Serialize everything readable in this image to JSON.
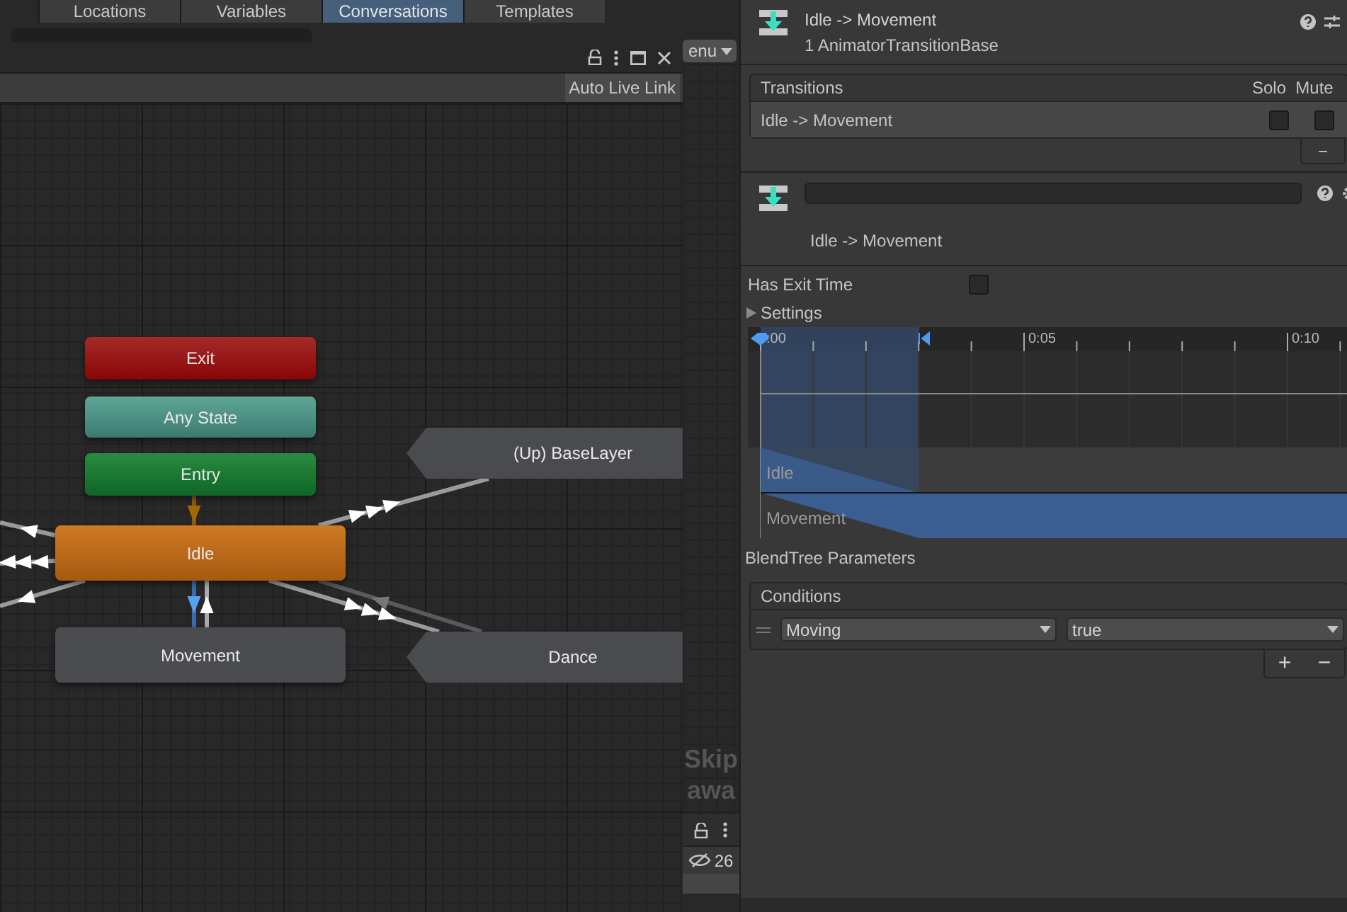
{
  "top_tabs": [
    {
      "label": "Locations",
      "selected": false
    },
    {
      "label": "Variables",
      "selected": false
    },
    {
      "label": "Conversations",
      "selected": true
    },
    {
      "label": "Templates",
      "selected": false
    }
  ],
  "menu_dropdown": {
    "label": "enu"
  },
  "graph": {
    "auto_live_link": "Auto Live Link",
    "nodes": [
      {
        "kind": "exit",
        "label": "Exit"
      },
      {
        "kind": "any",
        "label": "Any State"
      },
      {
        "kind": "entry",
        "label": "Entry"
      },
      {
        "kind": "default",
        "label": "Idle"
      },
      {
        "kind": "state",
        "label": "Movement"
      },
      {
        "kind": "sub",
        "label": "(Up) BaseLayer"
      },
      {
        "kind": "sub",
        "label": "Dance"
      }
    ]
  },
  "side_panel": {
    "texts": [
      "Skip",
      "awa"
    ],
    "hidden_count": "26"
  },
  "inspector": {
    "title": "Idle -> Movement",
    "subtitle": "1 AnimatorTransitionBase",
    "transitions": {
      "title": "Transitions",
      "columns": [
        "Solo",
        "Mute"
      ],
      "rows": [
        {
          "name": "Idle -> Movement",
          "solo": false,
          "mute": false
        }
      ],
      "remove": "−"
    },
    "transition_name": "Idle -> Movement",
    "has_exit_time": {
      "label": "Has Exit Time",
      "checked": false
    },
    "settings": {
      "label": "Settings",
      "expanded": false
    },
    "timeline": {
      "ticks": [
        ":00",
        "0:05",
        "0:10"
      ],
      "tracks": [
        {
          "name": "Idle"
        },
        {
          "name": "Movement"
        }
      ]
    },
    "blendtree_label": "BlendTree Parameters",
    "conditions": {
      "title": "Conditions",
      "rows": [
        {
          "parameter": "Moving",
          "value": "true"
        }
      ],
      "add": "+",
      "remove": "−"
    }
  }
}
